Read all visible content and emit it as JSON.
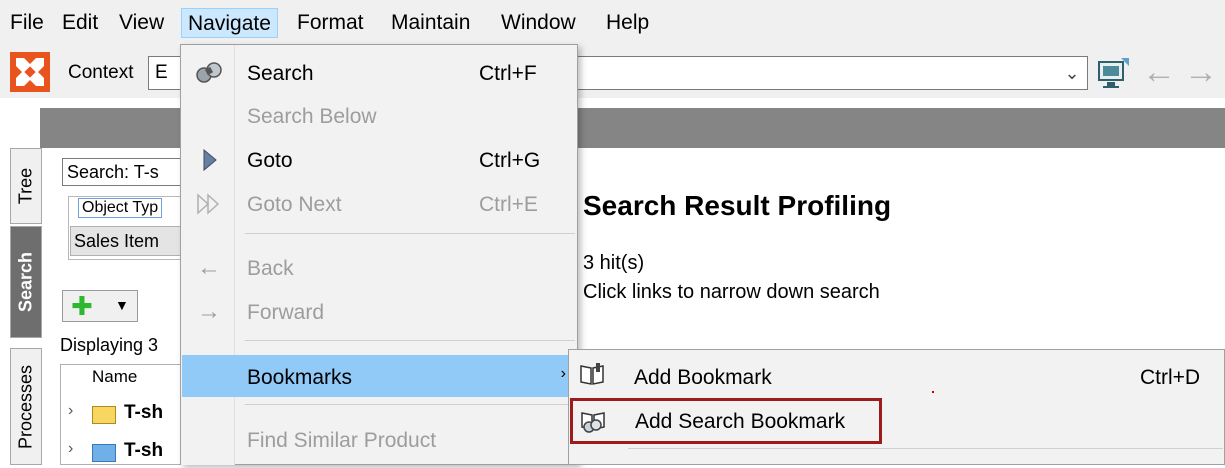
{
  "menubar": {
    "items": [
      "File",
      "Edit",
      "View",
      "Navigate",
      "Format",
      "Maintain",
      "Window",
      "Help"
    ],
    "active": "Navigate"
  },
  "toolbar": {
    "context_label": "Context",
    "context_value": "E"
  },
  "tabs": [
    "Tree",
    "Search",
    "Processes"
  ],
  "left_panel": {
    "search_value": "Search: T-s",
    "object_type_label": "Object Typ",
    "object_type_value": "Sales Item",
    "displaying": "Displaying 3",
    "column_name": "Name",
    "rows": [
      "T-sh",
      "T-sh"
    ]
  },
  "main": {
    "title": "Search Result Profiling",
    "hits": "3 hit(s)",
    "hint": "Click links to narrow down search"
  },
  "navigate_menu": {
    "search": {
      "label": "Search",
      "shortcut": "Ctrl+F"
    },
    "search_below": {
      "label": "Search Below"
    },
    "goto": {
      "label": "Goto",
      "shortcut": "Ctrl+G"
    },
    "goto_next": {
      "label": "Goto Next",
      "shortcut": "Ctrl+E"
    },
    "back": {
      "label": "Back"
    },
    "forward": {
      "label": "Forward"
    },
    "bookmarks": {
      "label": "Bookmarks"
    },
    "find_similar": {
      "label": "Find Similar Product"
    }
  },
  "bookmarks_submenu": {
    "add_bookmark": {
      "label": "Add Bookmark",
      "shortcut": "Ctrl+D"
    },
    "add_search_bookmark": {
      "label": "Add Search Bookmark"
    }
  },
  "colors": {
    "menu_highlight": "#91c9f7",
    "callout_border": "#9e1b1b",
    "logo": "#e8531e",
    "header_bar": "#858585"
  }
}
